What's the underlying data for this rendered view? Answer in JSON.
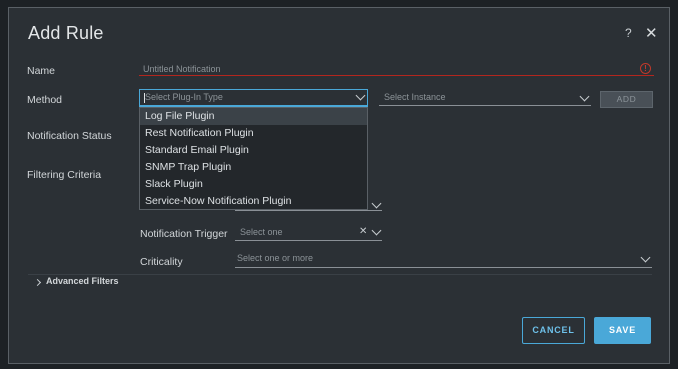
{
  "dialog": {
    "title": "Add Rule",
    "help_label": "?",
    "close_label": "✕"
  },
  "form": {
    "name": {
      "label": "Name",
      "placeholder": "Untitled Notification",
      "error_icon": "!"
    },
    "method": {
      "label": "Method",
      "plugin_placeholder": "Select Plug-In Type",
      "instance_placeholder": "Select Instance",
      "add_label": "ADD",
      "plugin_options": [
        "Log File Plugin",
        "Rest Notification Plugin",
        "Standard Email Plugin",
        "SNMP Trap Plugin",
        "Slack Plugin",
        "Service-Now Notification Plugin"
      ],
      "highlighted_option": "Log File Plugin"
    },
    "notification_status": {
      "label": "Notification Status"
    },
    "filtering_criteria": {
      "label": "Filtering Criteria"
    },
    "notification_trigger": {
      "label": "Notification Trigger",
      "placeholder": "Select one",
      "clear_label": "✕"
    },
    "criticality": {
      "label": "Criticality",
      "placeholder": "Select one or more"
    },
    "advanced_filters": {
      "label": "Advanced Filters"
    }
  },
  "footer": {
    "cancel_label": "CANCEL",
    "save_label": "SAVE"
  },
  "colors": {
    "accent": "#4aa8d8",
    "error": "#b3261e",
    "dialog_bg": "#2b3035"
  },
  "icons": [
    "help-icon",
    "close-icon",
    "error-icon",
    "chevron-down-icon",
    "chevron-right-icon",
    "clear-icon"
  ]
}
